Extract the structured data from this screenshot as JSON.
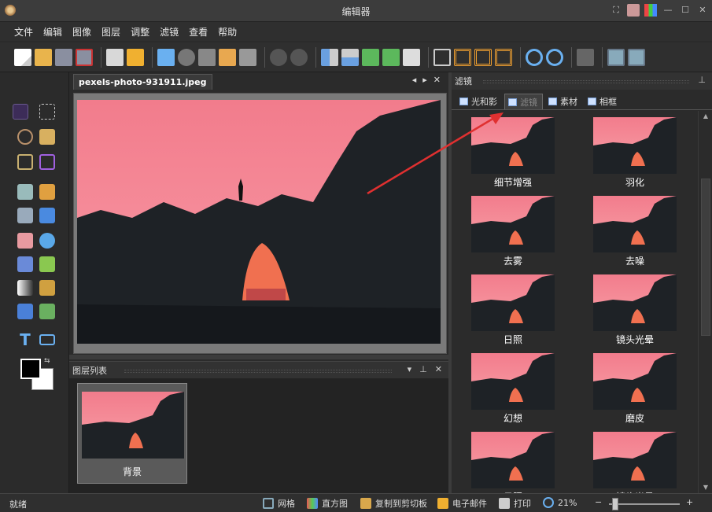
{
  "window": {
    "title": "编辑器"
  },
  "menu": [
    "文件",
    "编辑",
    "图像",
    "图层",
    "调整",
    "滤镜",
    "查看",
    "帮助"
  ],
  "document": {
    "tab": "pexels-photo-931911.jpeg"
  },
  "layers_panel": {
    "title": "图层列表",
    "layers": [
      {
        "name": "背景"
      }
    ]
  },
  "filter_panel": {
    "title": "滤镜",
    "tabs": [
      "光和影",
      "滤镜",
      "素材",
      "相框"
    ],
    "active_tab": "滤镜",
    "items": [
      "细节增强",
      "羽化",
      "去雾",
      "去噪",
      "日照",
      "镜头光晕",
      "幻想",
      "磨皮",
      "日照",
      "镜头光晕"
    ]
  },
  "status": {
    "text": "就绪",
    "grid": "网格",
    "histogram": "直方图",
    "copy_clipboard": "复制到剪切板",
    "email": "电子邮件",
    "print": "打印",
    "zoom": "21%",
    "minus": "−",
    "plus": "+"
  },
  "colors": {
    "accent": "#f27c8c",
    "arrow": "#e03030"
  }
}
